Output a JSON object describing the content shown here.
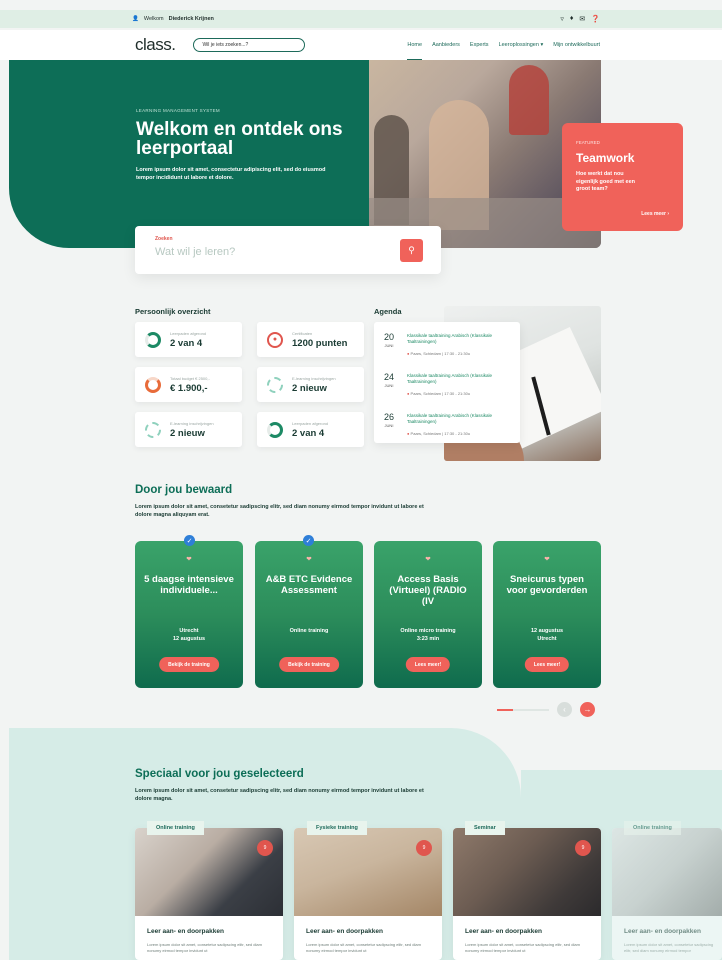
{
  "topbar": {
    "welcome": "Welkom",
    "username": "Diederick Krijnen",
    "icons": [
      "basket-icon",
      "bell-icon",
      "mail-icon",
      "help-icon"
    ]
  },
  "nav": {
    "logo": "class.",
    "search_placeholder": "Wil je iets zoeken...?",
    "items": [
      "Home",
      "Aanbieders",
      "Experts",
      "Leeroplossingen ▾",
      "Mijn ontwikkelbuurt"
    ]
  },
  "hero": {
    "kicker": "LEARNING MANAGEMENT SYSTEM",
    "title": "Welkom en ontdek ons leerportaal",
    "subtitle": "Lorem ipsum dolor sit amet, consectetur adipiscing elit, sed do eiusmod tempor incididunt ut labore et dolore.",
    "feature": {
      "kicker": "FEATURED",
      "title": "Teamwork",
      "text": "Hoe werkt dat nou eigenlijk goed met een groot team?",
      "link": "Lees meer ›"
    }
  },
  "search": {
    "label": "Zoeken",
    "placeholder": "Wat wil je leren?",
    "icon": "search-icon"
  },
  "overview": {
    "title": "Persoonlijk overzicht",
    "stats": [
      {
        "label": "Leerpaden afgerond",
        "value": "2 van 4"
      },
      {
        "label": "Certificaten",
        "value": "1200 punten"
      },
      {
        "label": "Totaal budget € 2500,-",
        "value": "€ 1.900,-"
      },
      {
        "label": "E-learning inschrijvingen",
        "value": "2 nieuw"
      },
      {
        "label": "E-learning inschrijvingen",
        "value": "2 nieuw"
      },
      {
        "label": "Leerpaden afgerond",
        "value": "2 van 4"
      }
    ]
  },
  "agenda": {
    "title": "Agenda",
    "items": [
      {
        "day": "20",
        "month": "JUNI",
        "title": "Klassikale taaltraining Arabisch (Klassikale Taaltrainingen)",
        "location": "Paars, Schiedam | 17:30 - 21:30u"
      },
      {
        "day": "24",
        "month": "JUNI",
        "title": "Klassikale taaltraining Arabisch (Klassikale Taaltrainingen)",
        "location": "Paars, Schiedam | 17:30 - 21:30u"
      },
      {
        "day": "26",
        "month": "JUNI",
        "title": "Klassikale taaltraining Arabisch (Klassikale Taaltrainingen)",
        "location": "Paars, Schiedam | 17:30 - 21:30u"
      }
    ]
  },
  "saved": {
    "title": "Door jou bewaard",
    "desc": "Lorem ipsum dolor sit amet, consetetur sadipscing elitr, sed diam nonumy eirmod tempor invidunt ut labore et dolore magna aliquyam erat.",
    "cards": [
      {
        "title": "5 daagse intensieve individuele...",
        "meta1": "Utrecht",
        "meta2": "12 augustus",
        "cta": "Bekijk de training"
      },
      {
        "title": "A&B ETC Evidence Assessment",
        "meta1": "Online training",
        "meta2": "",
        "cta": "Bekijk de training"
      },
      {
        "title": "Access Basis (Virtueel) (RADIO (IV",
        "meta1": "Online micro training",
        "meta2": "3:23 min",
        "cta": "Lees meer!"
      },
      {
        "title": "Sneicurus typen voor gevorderden",
        "meta1": "12 augustus",
        "meta2": "Utrecht",
        "cta": "Lees meer!"
      }
    ]
  },
  "selected": {
    "title": "Speciaal voor jou geselecteerd",
    "desc": "Lorem ipsum dolor sit amet, consetetur sadipscing elitr, sed diam nonumy eirmod tempor invidunt ut labore et dolore magna.",
    "cards": [
      {
        "tag": "Online training",
        "badge": "9",
        "title": "Leer aan- en doorpakken",
        "text": "Lorem ipsum dolor sit amet, consetetur sadipscing elitr, sed diam nonumy eirmod tempor invidunt ut"
      },
      {
        "tag": "Fysieke training",
        "badge": "9",
        "title": "Leer aan- en doorpakken",
        "text": "Lorem ipsum dolor sit amet, consetetur sadipscing elitr, sed diam nonumy eirmod tempor invidunt ut"
      },
      {
        "tag": "Seminar",
        "badge": "9",
        "title": "Leer aan- en doorpakken",
        "text": "Lorem ipsum dolor sit amet, consetetur sadipscing elitr, sed diam nonumy eirmod tempor invidunt ut"
      },
      {
        "tag": "Online training",
        "badge": "",
        "title": "Leer aan- en doorpakken",
        "text": "Lorem ipsum dolor sit amet, consetetur sadipscing elitr, sed diam nonumy eirmod tempor"
      }
    ]
  },
  "colors": {
    "primary": "#0d6e57",
    "accent": "#f0625a",
    "teal_bg": "#d6ece7"
  }
}
